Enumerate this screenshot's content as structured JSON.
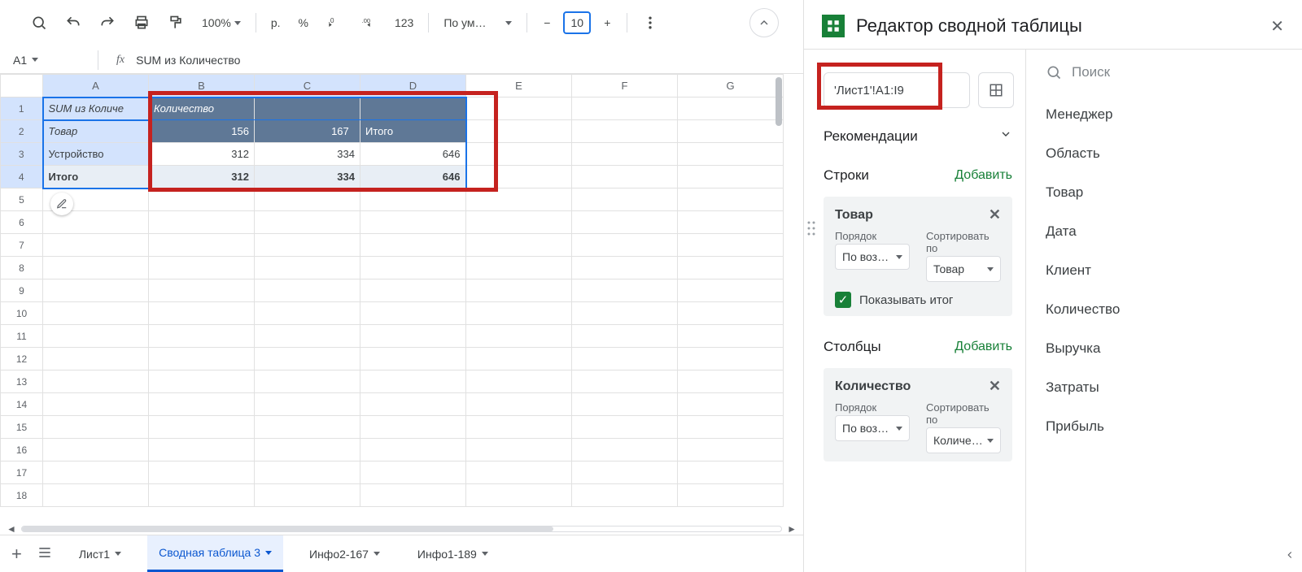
{
  "toolbar": {
    "zoom": "100%",
    "currency": "р.",
    "percent": "%",
    "num123": "123",
    "font": "По ум…",
    "font_size": "10"
  },
  "namebox": {
    "cell": "A1",
    "fx_label": "fx",
    "formula": "SUM из Количество"
  },
  "columns": [
    "A",
    "B",
    "C",
    "D",
    "E",
    "F",
    "G"
  ],
  "rows_count": 18,
  "cells": {
    "A1": "SUM из Количе",
    "B1": "Количество",
    "A2": "Товар",
    "B2": "156",
    "C2": "167",
    "D2": "Итого",
    "A3": "Устройство",
    "B3": "312",
    "C3": "334",
    "D3": "646",
    "A4": "Итого",
    "B4": "312",
    "C4": "334",
    "D4": "646"
  },
  "tabs": {
    "add": "+",
    "items": [
      {
        "label": "Лист1",
        "active": false
      },
      {
        "label": "Сводная таблица 3",
        "active": true
      },
      {
        "label": "Инфо2-167",
        "active": false
      },
      {
        "label": "Инфо1-189",
        "active": false
      }
    ]
  },
  "panel": {
    "title": "Редактор сводной таблицы",
    "range": "'Лист1'!A1:I9",
    "recommendations_label": "Рекомендации",
    "rows_label": "Строки",
    "cols_label": "Столбцы",
    "add_label": "Добавить",
    "card_rows": {
      "title": "Товар",
      "order_label": "Порядок",
      "order_value": "По воз…",
      "sort_label": "Сортировать по",
      "sort_value": "Товар",
      "show_total": "Показывать итог"
    },
    "card_cols": {
      "title": "Количество",
      "order_label": "Порядок",
      "order_value": "По воз…",
      "sort_label": "Сортировать по",
      "sort_value": "Количе…"
    },
    "search_placeholder": "Поиск",
    "fields": [
      "Менеджер",
      "Область",
      "Товар",
      "Дата",
      "Клиент",
      "Количество",
      "Выручка",
      "Затраты",
      "Прибыль"
    ]
  }
}
